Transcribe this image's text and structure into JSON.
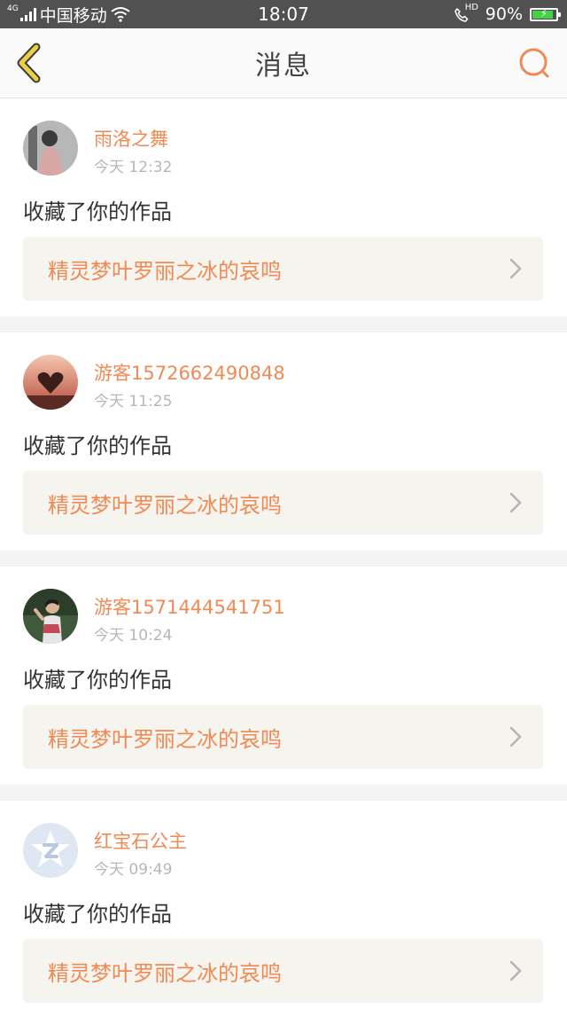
{
  "status_bar": {
    "network": "4G",
    "carrier": "中国移动",
    "time": "18:07",
    "call_badge": "HD",
    "battery": "90%",
    "battery_level": 0.9,
    "icons": [
      "signal-icon",
      "wifi-icon",
      "call-hd-icon",
      "battery-icon"
    ]
  },
  "header": {
    "title": "消息",
    "back_icon": "back-chevron-icon",
    "search_icon": "search-icon",
    "accent_color": "#f08a55",
    "back_color": "#e9cf4a"
  },
  "messages": [
    {
      "user": "雨洛之舞",
      "time": "今天 12:32",
      "action": "收藏了你的作品",
      "work": "精灵梦叶罗丽之冰的哀鸣",
      "avatar": "photo-avatar-girl-bw"
    },
    {
      "user": "游客1572662490848",
      "time": "今天 11:25",
      "action": "收藏了你的作品",
      "work": "精灵梦叶罗丽之冰的哀鸣",
      "avatar": "photo-avatar-heart-sunset"
    },
    {
      "user": "游客1571444541751",
      "time": "今天 10:24",
      "action": "收藏了你的作品",
      "work": "精灵梦叶罗丽之冰的哀鸣",
      "avatar": "photo-avatar-child-outdoor"
    },
    {
      "user": "红宝石公主",
      "time": "今天 09:49",
      "action": "收藏了你的作品",
      "work": "精灵梦叶罗丽之冰的哀鸣",
      "avatar": "default-qq-avatar"
    }
  ]
}
